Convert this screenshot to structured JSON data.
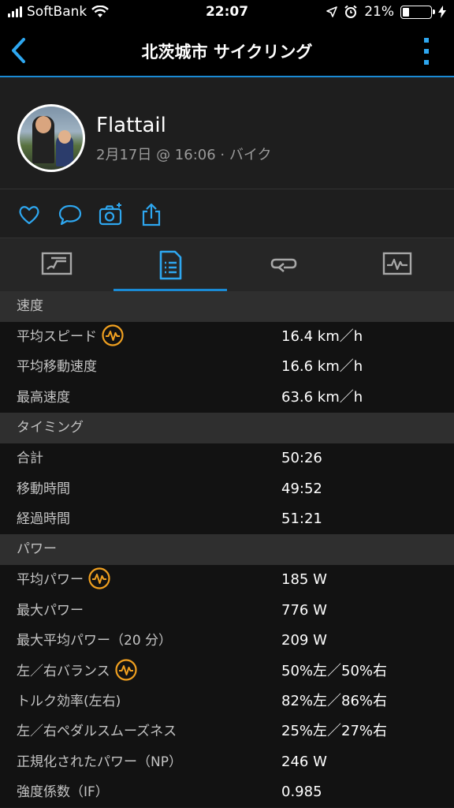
{
  "status_bar": {
    "carrier": "SoftBank",
    "time": "22:07",
    "battery": "21%"
  },
  "nav": {
    "title": "北茨城市 サイクリング"
  },
  "profile": {
    "name": "Flattail",
    "subtitle": "2月17日 @ 16:06 · バイク"
  },
  "sections": [
    {
      "title": "速度",
      "rows": [
        {
          "label": "平均スピード",
          "value": "16.4 km／h",
          "badge": true
        },
        {
          "label": "平均移動速度",
          "value": "16.6 km／h",
          "badge": false
        },
        {
          "label": "最高速度",
          "value": "63.6 km／h",
          "badge": false
        }
      ]
    },
    {
      "title": "タイミング",
      "rows": [
        {
          "label": "合計",
          "value": "50:26",
          "badge": false
        },
        {
          "label": "移動時間",
          "value": "49:52",
          "badge": false
        },
        {
          "label": "経過時間",
          "value": "51:21",
          "badge": false
        }
      ]
    },
    {
      "title": "パワー",
      "rows": [
        {
          "label": "平均パワー",
          "value": "185 W",
          "badge": true
        },
        {
          "label": "最大パワー",
          "value": "776 W",
          "badge": false
        },
        {
          "label": "最大平均パワー（20 分）",
          "value": "209 W",
          "badge": false
        },
        {
          "label": "左／右バランス",
          "value": "50%左／50%右",
          "badge": true
        },
        {
          "label": "トルク効率(左右)",
          "value": "82%左／86%右",
          "badge": false
        },
        {
          "label": "左／右ペダルスムーズネス",
          "value": "25%左／27%右",
          "badge": false
        },
        {
          "label": "正規化されたパワー（NP）",
          "value": "246 W",
          "badge": false
        },
        {
          "label": "強度係数（IF）",
          "value": "0.985",
          "badge": false
        }
      ]
    }
  ],
  "colors": {
    "accent": "#1a8ad4",
    "badge": "#f0a020"
  }
}
